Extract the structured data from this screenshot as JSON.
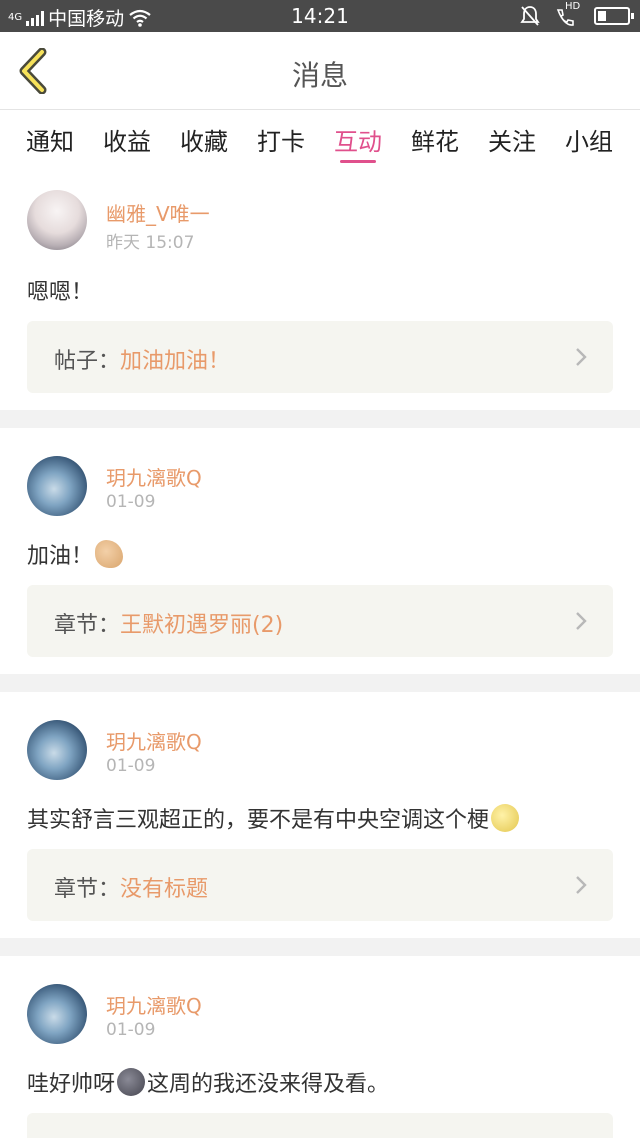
{
  "status_bar": {
    "network": "4G",
    "carrier": "中国移动",
    "time": "14:21",
    "hd": "HD",
    "battery_level": 0.3,
    "icons": [
      "signal-icon",
      "wifi-icon",
      "mute-icon",
      "hd-call-icon",
      "battery-icon"
    ]
  },
  "header": {
    "title": "消息",
    "back_icon": "chevron-left-icon"
  },
  "tabs": [
    {
      "label": "通知"
    },
    {
      "label": "收益"
    },
    {
      "label": "收藏"
    },
    {
      "label": "打卡"
    },
    {
      "label": "互动",
      "active": true
    },
    {
      "label": "鲜花"
    },
    {
      "label": "关注"
    },
    {
      "label": "小组"
    }
  ],
  "colors": {
    "accent": "#e0508c",
    "username": "#e89a6a",
    "ref_bg": "#f5f5f0"
  },
  "messages": [
    {
      "user": "幽雅_V唯一",
      "time": "昨天 15:07",
      "text": "嗯嗯！",
      "emoji": "",
      "text_after": "",
      "ref_type": "帖子：",
      "ref_title": "加油加油！"
    },
    {
      "user": "玥九漓歌Q",
      "time": "01-09",
      "text": "加油！",
      "emoji": "flexed-biceps",
      "text_after": "",
      "ref_type": "章节：",
      "ref_title": "王默初遇罗丽(2)"
    },
    {
      "user": "玥九漓歌Q",
      "time": "01-09",
      "text": "其实舒言三观超正的，要不是有中央空调这个梗",
      "emoji": "full-moon-face",
      "text_after": "",
      "ref_type": "章节：",
      "ref_title": "没有标题"
    },
    {
      "user": "玥九漓歌Q",
      "time": "01-09",
      "text": "哇好帅呀",
      "emoji": "new-moon-face",
      "text_after": "这周的我还没来得及看。",
      "ref_type": "",
      "ref_title": ""
    }
  ]
}
